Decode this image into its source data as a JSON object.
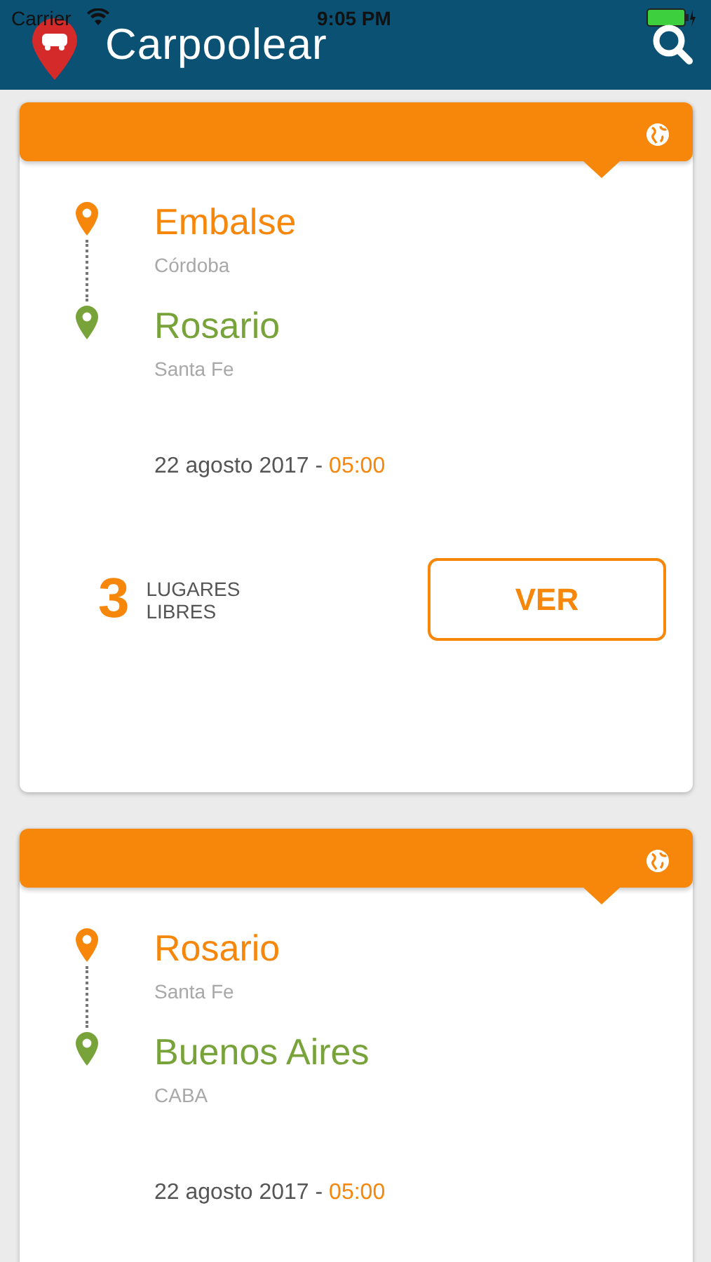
{
  "status_bar": {
    "carrier": "Carrier",
    "time": "9:05 PM"
  },
  "app_bar": {
    "title": "Carpoolear"
  },
  "trips": [
    {
      "origin": {
        "city": "Embalse",
        "region": "Córdoba"
      },
      "destination": {
        "city": "Rosario",
        "region": "Santa Fe"
      },
      "date": "22 agosto 2017",
      "separator": " - ",
      "time": "05:00",
      "seats": {
        "count": "3",
        "label_1": "LUGARES",
        "label_2": "LIBRES"
      },
      "button": "VER"
    },
    {
      "origin": {
        "city": "Rosario",
        "region": "Santa Fe"
      },
      "destination": {
        "city": "Buenos Aires",
        "region": "CABA"
      },
      "date": "22 agosto 2017",
      "separator": " - ",
      "time": "05:00"
    }
  ]
}
